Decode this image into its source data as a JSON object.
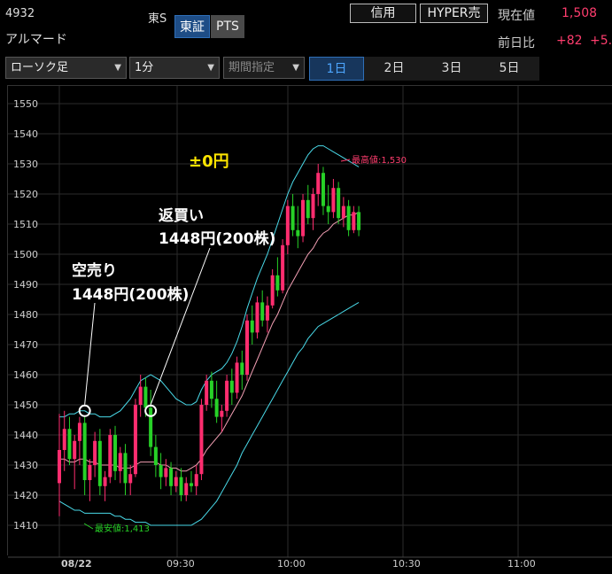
{
  "stock": {
    "code": "4932",
    "name": "アルマード",
    "exchange": "東S"
  },
  "market_buttons": {
    "tse": "東証",
    "pts": "PTS"
  },
  "trade_buttons": {
    "credit": "信用",
    "hyper_sell": "HYPER売"
  },
  "quote": {
    "current_label": "現在値",
    "current_value": "1,508",
    "change_label": "前日比",
    "change_value": "+82",
    "change_pct": "+5.",
    "value_color": "#ff3d6e"
  },
  "toolbar": {
    "chart_type": "ローソク足",
    "interval": "1分",
    "period": "期間指定",
    "ranges": [
      "1日",
      "2日",
      "3日",
      "5日"
    ],
    "active_range": "1日"
  },
  "annotations": {
    "result": "±0円",
    "short_sell_title": "空売り",
    "short_sell_detail": "1448円(200株)",
    "buy_back_title": "返買い",
    "buy_back_detail": "1448円(200株)",
    "high_label": "最高値:1,530",
    "low_label": "最安値:1,413"
  },
  "chart_data": {
    "type": "candlestick",
    "ylim": [
      1405,
      1555
    ],
    "y_ticks": [
      1410,
      1420,
      1430,
      1440,
      1450,
      1460,
      1470,
      1480,
      1490,
      1500,
      1510,
      1520,
      1530,
      1540,
      1550
    ],
    "x_tick_labels": [
      "08/22",
      "09:30",
      "10:00",
      "10:30",
      "11:00"
    ],
    "up_color": "#ff2d6f",
    "down_color": "#27d127",
    "candles": [
      {
        "o": 1424,
        "h": 1447,
        "l": 1413,
        "c": 1435
      },
      {
        "o": 1435,
        "h": 1448,
        "l": 1428,
        "c": 1442
      },
      {
        "o": 1442,
        "h": 1446,
        "l": 1430,
        "c": 1432
      },
      {
        "o": 1432,
        "h": 1440,
        "l": 1422,
        "c": 1438
      },
      {
        "o": 1438,
        "h": 1446,
        "l": 1430,
        "c": 1444
      },
      {
        "o": 1444,
        "h": 1446,
        "l": 1420,
        "c": 1425
      },
      {
        "o": 1425,
        "h": 1432,
        "l": 1418,
        "c": 1430
      },
      {
        "o": 1430,
        "h": 1441,
        "l": 1426,
        "c": 1438
      },
      {
        "o": 1438,
        "h": 1442,
        "l": 1420,
        "c": 1423
      },
      {
        "o": 1423,
        "h": 1428,
        "l": 1418,
        "c": 1426
      },
      {
        "o": 1426,
        "h": 1442,
        "l": 1424,
        "c": 1440
      },
      {
        "o": 1440,
        "h": 1443,
        "l": 1425,
        "c": 1428
      },
      {
        "o": 1428,
        "h": 1436,
        "l": 1424,
        "c": 1434
      },
      {
        "o": 1434,
        "h": 1437,
        "l": 1420,
        "c": 1424
      },
      {
        "o": 1424,
        "h": 1430,
        "l": 1420,
        "c": 1427
      },
      {
        "o": 1427,
        "h": 1452,
        "l": 1426,
        "c": 1450
      },
      {
        "o": 1450,
        "h": 1460,
        "l": 1446,
        "c": 1456
      },
      {
        "o": 1456,
        "h": 1459,
        "l": 1446,
        "c": 1449
      },
      {
        "o": 1449,
        "h": 1455,
        "l": 1433,
        "c": 1436
      },
      {
        "o": 1436,
        "h": 1440,
        "l": 1426,
        "c": 1430
      },
      {
        "o": 1430,
        "h": 1434,
        "l": 1422,
        "c": 1426
      },
      {
        "o": 1426,
        "h": 1432,
        "l": 1423,
        "c": 1429
      },
      {
        "o": 1429,
        "h": 1431,
        "l": 1420,
        "c": 1423
      },
      {
        "o": 1423,
        "h": 1428,
        "l": 1421,
        "c": 1426
      },
      {
        "o": 1426,
        "h": 1429,
        "l": 1418,
        "c": 1420
      },
      {
        "o": 1420,
        "h": 1426,
        "l": 1418,
        "c": 1424
      },
      {
        "o": 1424,
        "h": 1428,
        "l": 1421,
        "c": 1423
      },
      {
        "o": 1423,
        "h": 1430,
        "l": 1420,
        "c": 1427
      },
      {
        "o": 1427,
        "h": 1452,
        "l": 1425,
        "c": 1450
      },
      {
        "o": 1450,
        "h": 1460,
        "l": 1448,
        "c": 1458
      },
      {
        "o": 1458,
        "h": 1461,
        "l": 1449,
        "c": 1452
      },
      {
        "o": 1452,
        "h": 1458,
        "l": 1444,
        "c": 1446
      },
      {
        "o": 1446,
        "h": 1450,
        "l": 1441,
        "c": 1448
      },
      {
        "o": 1448,
        "h": 1460,
        "l": 1446,
        "c": 1458
      },
      {
        "o": 1458,
        "h": 1462,
        "l": 1450,
        "c": 1454
      },
      {
        "o": 1454,
        "h": 1466,
        "l": 1452,
        "c": 1464
      },
      {
        "o": 1464,
        "h": 1468,
        "l": 1455,
        "c": 1460
      },
      {
        "o": 1460,
        "h": 1480,
        "l": 1458,
        "c": 1478
      },
      {
        "o": 1478,
        "h": 1483,
        "l": 1470,
        "c": 1474
      },
      {
        "o": 1474,
        "h": 1486,
        "l": 1472,
        "c": 1484
      },
      {
        "o": 1484,
        "h": 1488,
        "l": 1476,
        "c": 1478
      },
      {
        "o": 1478,
        "h": 1486,
        "l": 1474,
        "c": 1483
      },
      {
        "o": 1483,
        "h": 1495,
        "l": 1482,
        "c": 1493
      },
      {
        "o": 1493,
        "h": 1499,
        "l": 1486,
        "c": 1488
      },
      {
        "o": 1488,
        "h": 1505,
        "l": 1487,
        "c": 1503
      },
      {
        "o": 1503,
        "h": 1518,
        "l": 1500,
        "c": 1516
      },
      {
        "o": 1516,
        "h": 1520,
        "l": 1506,
        "c": 1508
      },
      {
        "o": 1508,
        "h": 1516,
        "l": 1502,
        "c": 1506
      },
      {
        "o": 1506,
        "h": 1520,
        "l": 1504,
        "c": 1518
      },
      {
        "o": 1518,
        "h": 1523,
        "l": 1510,
        "c": 1512
      },
      {
        "o": 1512,
        "h": 1522,
        "l": 1508,
        "c": 1520
      },
      {
        "o": 1520,
        "h": 1530,
        "l": 1516,
        "c": 1527
      },
      {
        "o": 1527,
        "h": 1529,
        "l": 1513,
        "c": 1516
      },
      {
        "o": 1516,
        "h": 1523,
        "l": 1510,
        "c": 1514
      },
      {
        "o": 1514,
        "h": 1525,
        "l": 1512,
        "c": 1522
      },
      {
        "o": 1522,
        "h": 1524,
        "l": 1510,
        "c": 1512
      },
      {
        "o": 1512,
        "h": 1519,
        "l": 1509,
        "c": 1516
      },
      {
        "o": 1516,
        "h": 1518,
        "l": 1506,
        "c": 1508
      },
      {
        "o": 1508,
        "h": 1516,
        "l": 1507,
        "c": 1514
      },
      {
        "o": 1514,
        "h": 1516,
        "l": 1506,
        "c": 1508
      }
    ],
    "ma": [
      1432,
      1432,
      1431,
      1431,
      1432,
      1432,
      1431,
      1431,
      1430,
      1430,
      1430,
      1430,
      1429,
      1429,
      1429,
      1430,
      1431,
      1431,
      1431,
      1431,
      1430,
      1430,
      1429,
      1429,
      1428,
      1428,
      1429,
      1430,
      1432,
      1435,
      1437,
      1439,
      1441,
      1444,
      1447,
      1450,
      1453,
      1457,
      1461,
      1465,
      1469,
      1473,
      1477,
      1480,
      1484,
      1488,
      1491,
      1494,
      1497,
      1500,
      1502,
      1505,
      1507,
      1508,
      1510,
      1511,
      1512,
      1513,
      1513,
      1514
    ],
    "upper_band": [
      1446,
      1446,
      1447,
      1447,
      1448,
      1448,
      1447,
      1447,
      1446,
      1446,
      1446,
      1447,
      1448,
      1450,
      1452,
      1455,
      1458,
      1459,
      1460,
      1459,
      1458,
      1456,
      1454,
      1452,
      1451,
      1450,
      1450,
      1451,
      1455,
      1458,
      1460,
      1461,
      1462,
      1464,
      1467,
      1471,
      1476,
      1482,
      1487,
      1492,
      1496,
      1500,
      1505,
      1510,
      1515,
      1520,
      1524,
      1527,
      1530,
      1533,
      1535,
      1536,
      1536,
      1535,
      1534,
      1533,
      1532,
      1531,
      1530,
      1529
    ],
    "lower_band": [
      1418,
      1417,
      1416,
      1415,
      1415,
      1414,
      1414,
      1414,
      1414,
      1414,
      1414,
      1413,
      1413,
      1412,
      1412,
      1411,
      1411,
      1411,
      1410,
      1410,
      1410,
      1410,
      1410,
      1410,
      1410,
      1410,
      1410,
      1411,
      1412,
      1414,
      1416,
      1418,
      1421,
      1424,
      1427,
      1430,
      1434,
      1437,
      1440,
      1443,
      1446,
      1449,
      1452,
      1455,
      1458,
      1461,
      1464,
      1467,
      1469,
      1472,
      1474,
      1476,
      1477,
      1478,
      1479,
      1480,
      1481,
      1482,
      1483,
      1484
    ],
    "trades": [
      {
        "label": "空売り",
        "price": 1448,
        "candle_index": 5
      },
      {
        "label": "返買い",
        "price": 1448,
        "candle_index": 18
      }
    ]
  }
}
